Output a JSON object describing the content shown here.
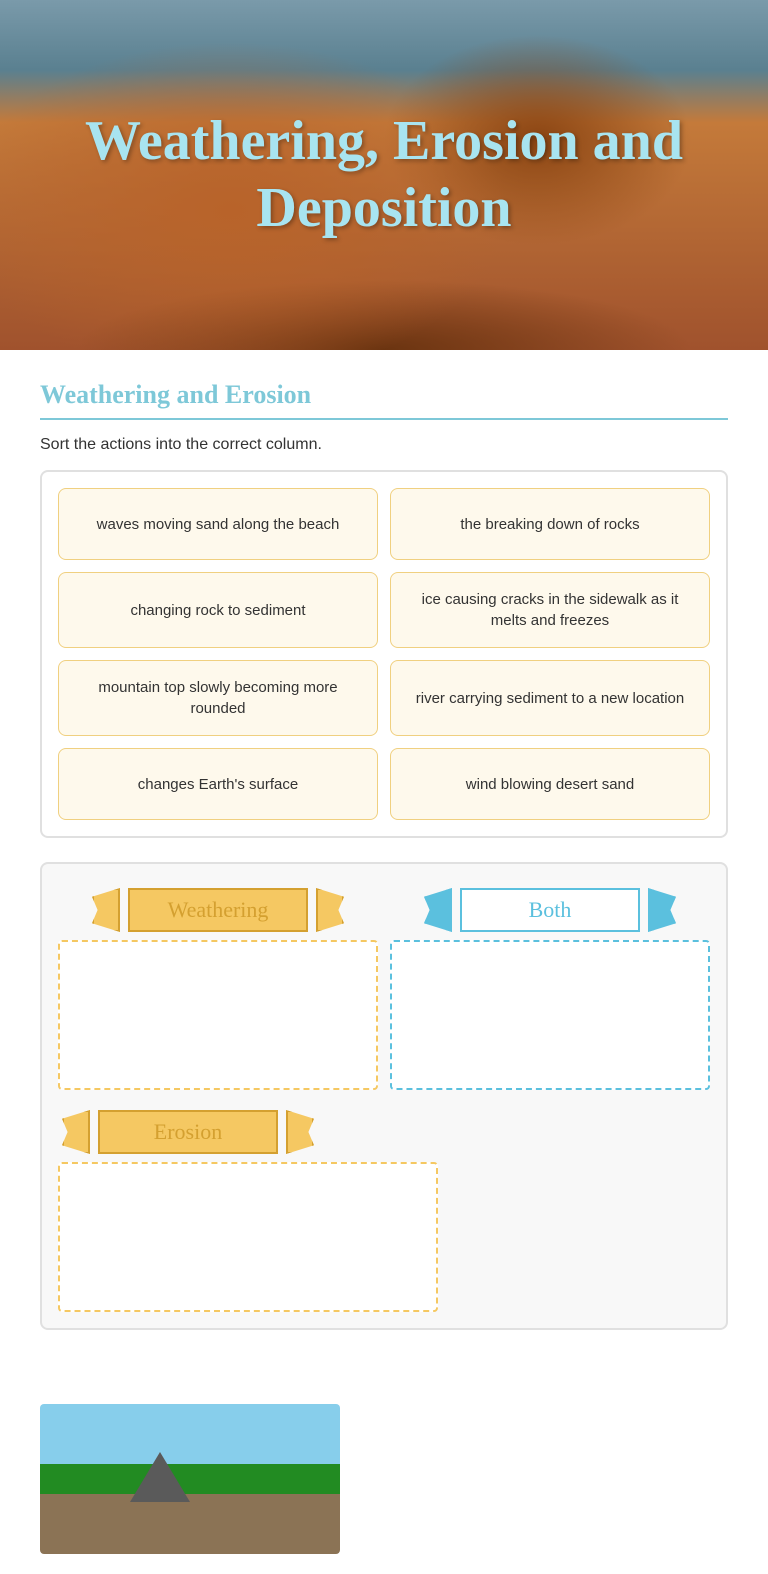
{
  "hero": {
    "title": "Weathering, Erosion and Deposition"
  },
  "section": {
    "title": "Weathering and Erosion",
    "instruction": "Sort the actions into the correct column."
  },
  "cards": [
    {
      "id": "card1",
      "text": "waves moving sand along the beach"
    },
    {
      "id": "card2",
      "text": "the breaking down of rocks"
    },
    {
      "id": "card3",
      "text": "changing rock to sediment"
    },
    {
      "id": "card4",
      "text": "ice causing cracks in the sidewalk as it melts and freezes"
    },
    {
      "id": "card5",
      "text": "mountain top slowly becoming more rounded"
    },
    {
      "id": "card6",
      "text": "river carrying sediment to a new location"
    },
    {
      "id": "card7",
      "text": "changes Earth's surface"
    },
    {
      "id": "card8",
      "text": "wind blowing desert sand"
    }
  ],
  "dropzones": {
    "weathering": {
      "label": "Weathering"
    },
    "both": {
      "label": "Both"
    },
    "erosion": {
      "label": "Erosion"
    }
  }
}
